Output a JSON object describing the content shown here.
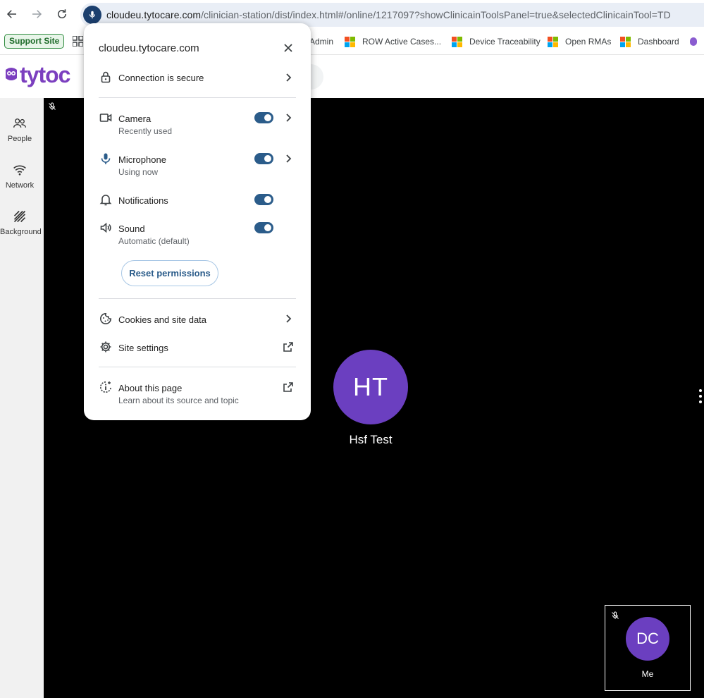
{
  "browser": {
    "url_host": "cloudeu.tytocare.com",
    "url_path": "/clinician-station/dist/index.html#/online/1217097?showClinicainToolsPanel=true&selectedClinicainTool=TD",
    "bookmarks": {
      "support_site": "Support Site",
      "admin": "Admin",
      "row_active_cases": "ROW Active Cases...",
      "device_traceability": "Device Traceability",
      "open_rmas": "Open RMAs",
      "dashboard": "Dashboard"
    }
  },
  "app": {
    "logo_text": "tytoc",
    "rail": [
      {
        "label": "People",
        "icon": "people-icon"
      },
      {
        "label": "Network",
        "icon": "wifi-icon"
      },
      {
        "label": "Background",
        "icon": "background-icon"
      }
    ],
    "participant": {
      "initials": "HT",
      "name": "Hsf Test"
    },
    "self": {
      "initials": "DC",
      "name": "Me"
    }
  },
  "popup": {
    "title": "cloudeu.tytocare.com",
    "connection": "Connection is secure",
    "permissions": [
      {
        "label": "Camera",
        "sub": "Recently used",
        "enabled": true
      },
      {
        "label": "Microphone",
        "sub": "Using now",
        "enabled": true
      },
      {
        "label": "Notifications",
        "sub": "",
        "enabled": true
      },
      {
        "label": "Sound",
        "sub": "Automatic (default)",
        "enabled": true
      }
    ],
    "reset_label": "Reset permissions",
    "cookies": "Cookies and site data",
    "site_settings": "Site settings",
    "about_title": "About this page",
    "about_sub": "Learn about its source and topic"
  },
  "colors": {
    "accent": "#2b5c8a",
    "avatar": "#6b3fc0",
    "brand": "#7b3fbf"
  }
}
